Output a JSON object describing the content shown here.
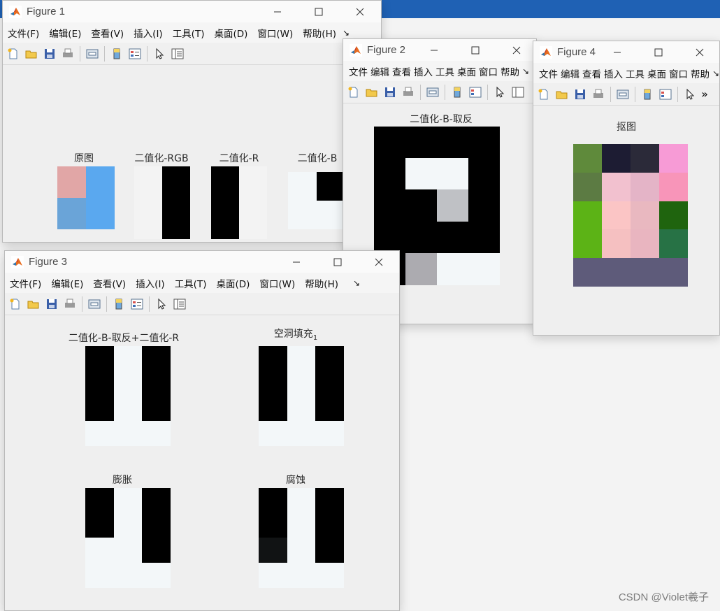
{
  "watermark": "CSDN @Violet羲子",
  "menu_items": [
    "文件(F)",
    "编辑(E)",
    "查看(V)",
    "插入(I)",
    "工具(T)",
    "桌面(D)",
    "窗口(W)",
    "帮助(H)"
  ],
  "menu_items_short": [
    "文件",
    "编辑",
    "查看",
    "插入",
    "工具",
    "桌面",
    "窗口",
    "帮助"
  ],
  "menu_items_fig4": [
    "文件",
    "编辑",
    "查看",
    "插入",
    "工具",
    "桌面",
    "窗口",
    "帮助"
  ],
  "overflow_glyph": "↘",
  "overflow_glyph_fig4": "»",
  "figures": {
    "fig1": {
      "title": "Figure 1",
      "axes": [
        "原图",
        "二值化-RGB",
        "二值化-R",
        "二值化-B"
      ]
    },
    "fig2": {
      "title": "Figure 2",
      "axes": [
        "二值化-B-取反"
      ]
    },
    "fig3": {
      "title": "Figure 3",
      "axes": [
        "二值化-B-取反+二值化-R",
        "空洞填充",
        "膨胀",
        "腐蚀"
      ],
      "subscript": "1"
    },
    "fig4": {
      "title": "Figure 4",
      "axes": [
        "抠图"
      ]
    }
  },
  "images": {
    "orig": {
      "cols": 2,
      "rows": 2,
      "colors": [
        "#e1a6a6",
        "#5aa8ef",
        "#6aa4d8",
        "#5aa8ef"
      ]
    },
    "rgb": {
      "cols": 2,
      "rows": 2,
      "colors": [
        "#f3f3f3",
        "#000000",
        "#f3f3f3",
        "#000000"
      ]
    },
    "r": {
      "cols": 2,
      "rows": 2,
      "colors": [
        "#000000",
        "#f3f3f3",
        "#000000",
        "#f3f3f3"
      ]
    },
    "b": {
      "cols": 2,
      "rows": 2,
      "colors": [
        "#f3f7f9",
        "#000000",
        "#f3f7f9",
        "#f3f7f9"
      ]
    },
    "b_inv": {
      "cols": 4,
      "rows": 5,
      "colors": [
        "#000000",
        "#000000",
        "#000000",
        "#000000",
        "#000000",
        "#f3f7f9",
        "#f3f7f9",
        "#000000",
        "#000000",
        "#000000",
        "#bfc1c5",
        "#000000",
        "#000000",
        "#000000",
        "#000000",
        "#000000",
        "#000000",
        "#acabb0",
        "#f3f7f9",
        "#f3f7f9"
      ]
    },
    "combined": {
      "cols": 3,
      "rows": 4,
      "colors": [
        "#000000",
        "#f3f7f9",
        "#000000",
        "#000000",
        "#f3f7f9",
        "#000000",
        "#000000",
        "#f3f7f9",
        "#000000",
        "#f3f7f9",
        "#f3f7f9",
        "#f3f7f9"
      ]
    },
    "filled": {
      "cols": 3,
      "rows": 4,
      "colors": [
        "#000000",
        "#f3f7f9",
        "#000000",
        "#000000",
        "#f3f7f9",
        "#000000",
        "#000000",
        "#f3f7f9",
        "#000000",
        "#f3f7f9",
        "#f3f7f9",
        "#f3f7f9"
      ]
    },
    "dilate": {
      "cols": 3,
      "rows": 4,
      "colors": [
        "#000000",
        "#f3f7f9",
        "#000000",
        "#000000",
        "#f3f7f9",
        "#000000",
        "#f3f7f9",
        "#f3f7f9",
        "#000000",
        "#f3f7f9",
        "#f3f7f9",
        "#f3f7f9"
      ]
    },
    "erode": {
      "cols": 3,
      "rows": 4,
      "colors": [
        "#000000",
        "#f3f7f9",
        "#000000",
        "#000000",
        "#f3f7f9",
        "#000000",
        "#111314",
        "#f3f7f9",
        "#000000",
        "#f3f7f9",
        "#f3f7f9",
        "#f3f7f9"
      ]
    },
    "cutout": {
      "cols": 4,
      "rows": 5,
      "colors": [
        "#5f8a3b",
        "#1d1c33",
        "#2b2a39",
        "#f79bd6",
        "#5c7b43",
        "#f2c1cf",
        "#e4b4c7",
        "#f895b9",
        "#5cb316",
        "#fbc5c5",
        "#e9b8c0",
        "#1f640e",
        "#5cb316",
        "#f5c0c1",
        "#e9b5c0",
        "#277245",
        "#5e5b7a",
        "#5e5b7a",
        "#5e5b7a",
        "#5e5b7a"
      ]
    }
  }
}
